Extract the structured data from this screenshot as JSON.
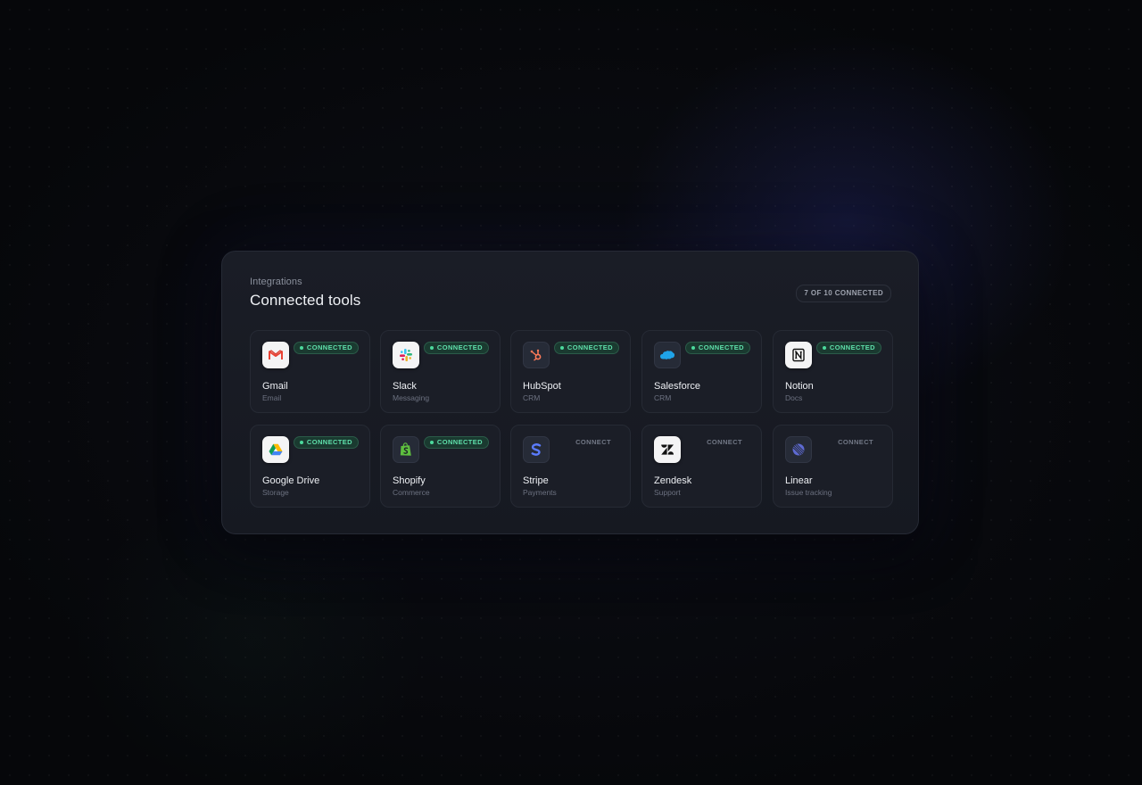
{
  "header": {
    "eyebrow": "Integrations",
    "title": "Connected tools",
    "count_badge": "7 OF 10 CONNECTED"
  },
  "integrations": [
    {
      "name": "Gmail",
      "category": "Email",
      "status": "CONNECTED",
      "icon": "gmail-icon"
    },
    {
      "name": "Slack",
      "category": "Messaging",
      "status": "CONNECTED",
      "icon": "slack-icon"
    },
    {
      "name": "HubSpot",
      "category": "CRM",
      "status": "CONNECTED",
      "icon": "hubspot-icon"
    },
    {
      "name": "Salesforce",
      "category": "CRM",
      "status": "CONNECTED",
      "icon": "salesforce-icon"
    },
    {
      "name": "Notion",
      "category": "Docs",
      "status": "CONNECTED",
      "icon": "notion-icon"
    },
    {
      "name": "Google Drive",
      "category": "Storage",
      "status": "CONNECTED",
      "icon": "google-drive-icon"
    },
    {
      "name": "Shopify",
      "category": "Commerce",
      "status": "CONNECTED",
      "icon": "shopify-icon"
    },
    {
      "name": "Stripe",
      "category": "Payments",
      "status": "CONNECT",
      "icon": "stripe-icon"
    },
    {
      "name": "Zendesk",
      "category": "Support",
      "status": "CONNECT",
      "icon": "zendesk-icon"
    },
    {
      "name": "Linear",
      "category": "Issue tracking",
      "status": "CONNECT",
      "icon": "linear-icon"
    }
  ],
  "colors": {
    "connected_text": "#5fe0ab",
    "connected_bg": "#1a3a30",
    "card_bg": "#1b1e27",
    "panel_bg": "#1a1d26",
    "page_bg": "#07080c"
  }
}
